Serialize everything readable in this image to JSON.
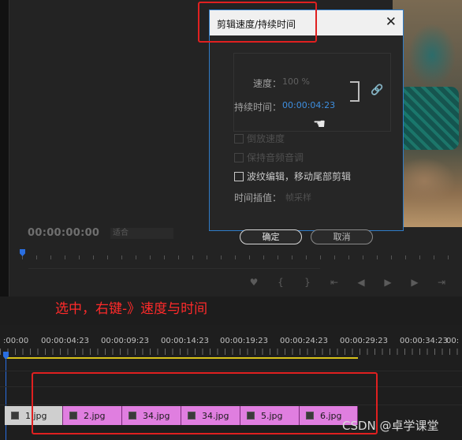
{
  "monitor": {
    "timecode": "00:00:00:00",
    "fit_label": "适合",
    "transport_icons": [
      "marker-icon",
      "mark-in-icon",
      "mark-out-icon",
      "go-to-in-icon",
      "step-back-icon",
      "play-icon",
      "step-forward-icon",
      "go-to-out-icon"
    ]
  },
  "dialog": {
    "title": "剪辑速度/持续时间",
    "close_glyph": "✕",
    "speed_label": "速度：",
    "speed_value": "100 %",
    "duration_label": "持续时间：",
    "duration_value": "00:00:04:23",
    "options": [
      {
        "label": "倒放速度",
        "checked": false,
        "enabled": false
      },
      {
        "label": "保持音频音调",
        "checked": false,
        "enabled": false
      },
      {
        "label": "波纹编辑，移动尾部剪辑",
        "checked": false,
        "enabled": true
      }
    ],
    "interp_label": "时间插值：",
    "interp_value": "帧采样",
    "ok_label": "确定",
    "cancel_label": "取消"
  },
  "annotation": "选中，右键-》速度与时间",
  "timeline": {
    "ruler_labels": [
      ":00:00",
      "00:00:04:23",
      "00:00:09:23",
      "00:00:14:23",
      "00:00:19:23",
      "00:00:24:23",
      "00:00:29:23",
      "00:00:34:23",
      "00:"
    ],
    "clips": [
      {
        "name": "1.jpg",
        "state": "selected"
      },
      {
        "name": "2.jpg",
        "state": "normal"
      },
      {
        "name": "34.jpg",
        "state": "normal"
      },
      {
        "name": "34.jpg",
        "state": "normal"
      },
      {
        "name": "5.jpg",
        "state": "normal"
      },
      {
        "name": "6.jpg",
        "state": "normal"
      }
    ]
  },
  "watermark": "CSDN @卓学课堂",
  "colors": {
    "accent_red": "#e02020",
    "clip_pink": "#e07ee0",
    "timecode_blue": "#3e8fe0",
    "work_area_yellow": "#d8c21a"
  }
}
